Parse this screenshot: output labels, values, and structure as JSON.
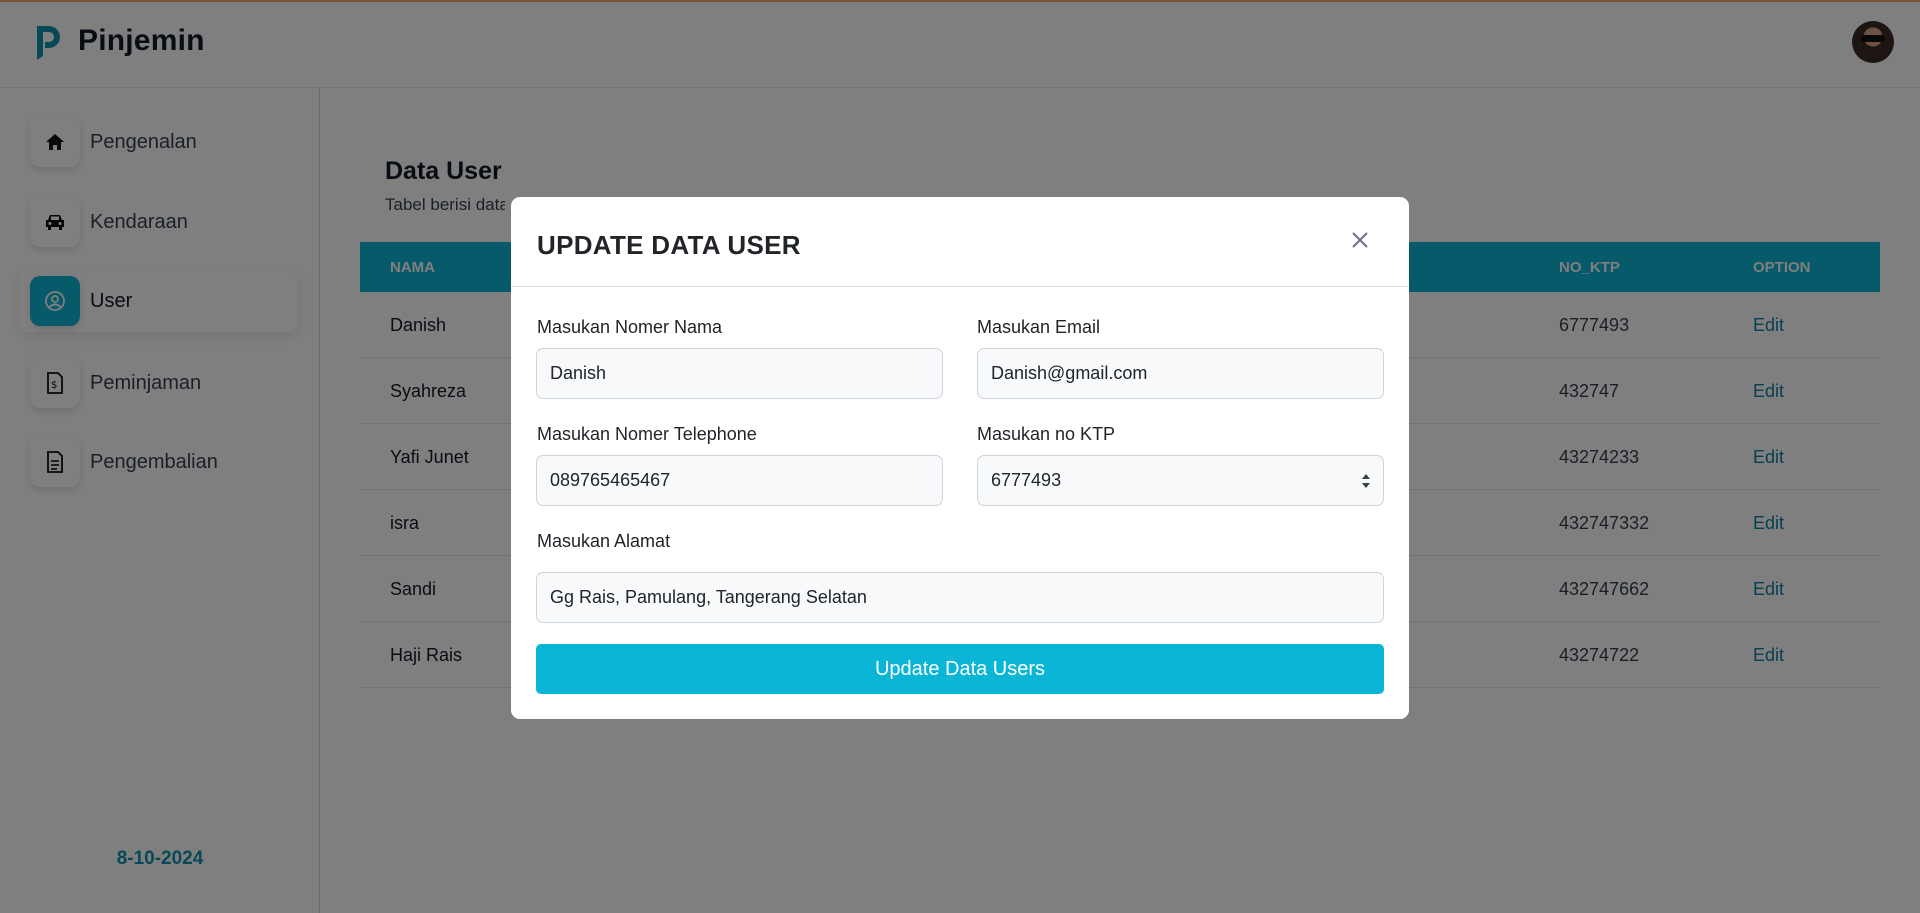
{
  "app": {
    "brand": "Pinjemin"
  },
  "sidebar": {
    "items": [
      {
        "label": "Pengenalan",
        "icon": "home-icon"
      },
      {
        "label": "Kendaraan",
        "icon": "car-icon"
      },
      {
        "label": "User",
        "icon": "user-circle-icon",
        "active": true
      },
      {
        "label": "Peminjaman",
        "icon": "document-dollar-icon"
      },
      {
        "label": "Pengembalian",
        "icon": "document-text-icon"
      }
    ],
    "date": "8-10-2024"
  },
  "main": {
    "title": "Data User",
    "subtitle": "Tabel berisi data"
  },
  "table": {
    "columns": [
      "NAMA",
      "NO_KTP",
      "OPTION"
    ],
    "rows": [
      {
        "nama": "Danish",
        "no_ktp": "6777493",
        "option": "Edit"
      },
      {
        "nama": "Syahreza",
        "no_ktp": "432747",
        "option": "Edit"
      },
      {
        "nama": "Yafi Junet",
        "no_ktp": "43274233",
        "option": "Edit"
      },
      {
        "nama": "isra",
        "no_ktp": "432747332",
        "option": "Edit"
      },
      {
        "nama": "Sandi",
        "no_ktp": "432747662",
        "option": "Edit"
      },
      {
        "nama": "Haji Rais",
        "no_ktp": "43274722",
        "option": "Edit"
      }
    ]
  },
  "modal": {
    "title": "UPDATE DATA USER",
    "fields": {
      "nama": {
        "label": "Masukan Nomer Nama",
        "value": "Danish"
      },
      "email": {
        "label": "Masukan Email",
        "value": "Danish@gmail.com"
      },
      "telephone": {
        "label": "Masukan Nomer Telephone",
        "value": "089765465467"
      },
      "ktp": {
        "label": "Masukan no KTP",
        "value": "6777493"
      },
      "alamat": {
        "label": "Masukan Alamat",
        "value": "Gg Rais, Pamulang, Tangerang Selatan"
      }
    },
    "submit_label": "Update Data Users"
  },
  "colors": {
    "accent": "#0fb4d3",
    "link": "#0e7fa3"
  }
}
